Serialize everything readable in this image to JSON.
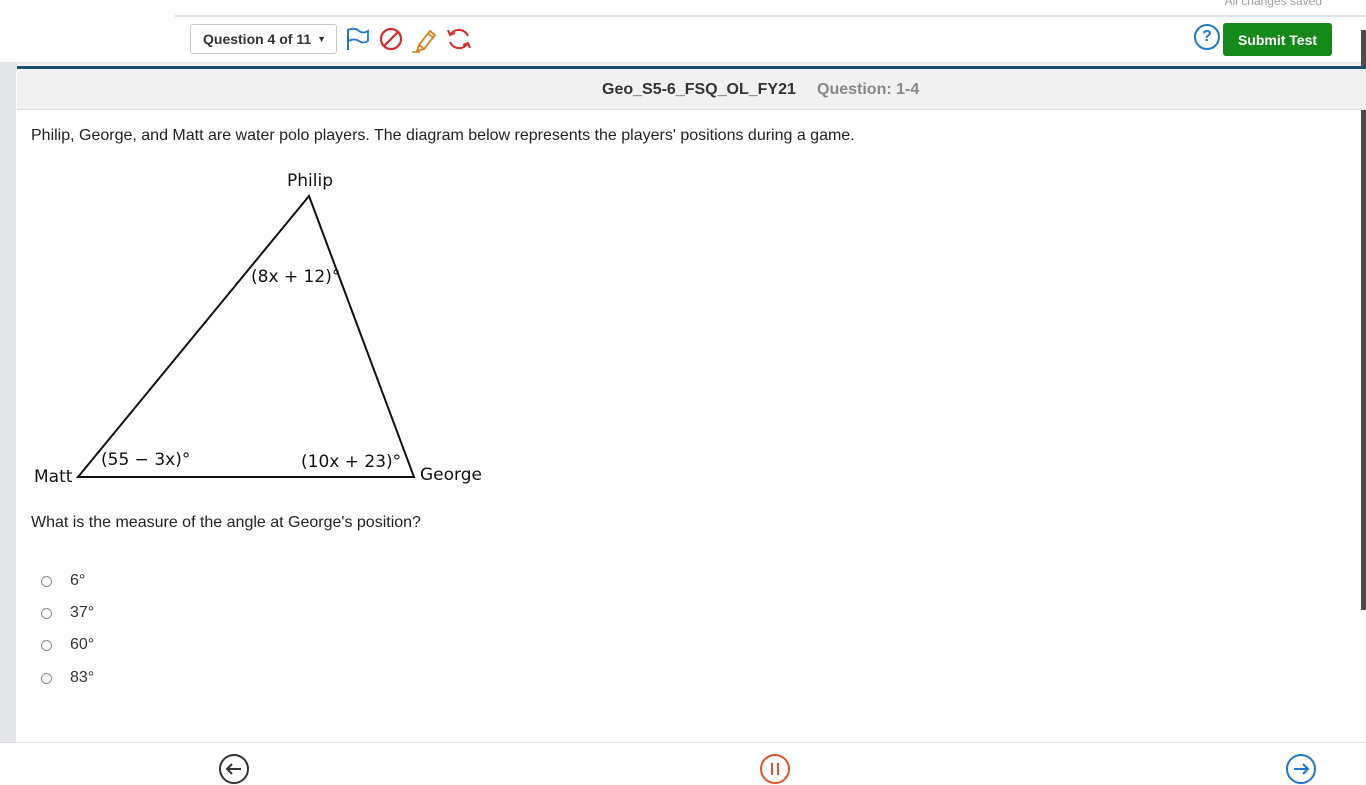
{
  "topbar": {
    "save_status": "All changes saved",
    "question_selector": "Question 4 of 11",
    "icons": [
      "flag-icon",
      "strikethrough-icon",
      "highlighter-icon",
      "reset-icon"
    ],
    "help_label": "?",
    "submit_label": "Submit Test"
  },
  "header": {
    "test_name": "Geo_S5-6_FSQ_OL_FY21",
    "question_code": "Question: 1-4"
  },
  "question": {
    "stem": "Philip, George, and Matt are water polo players.  The diagram below represents the players' positions during a game.",
    "diagram": {
      "vertex_philip": "Philip",
      "vertex_george": "George",
      "vertex_matt": "Matt",
      "angle_philip": "(8x + 12)°",
      "angle_george": "(10x + 23)°",
      "angle_matt": "(55 − 3x)°"
    },
    "prompt": "What is the measure of the angle at George's position?",
    "choices": [
      "6°",
      "37°",
      "60°",
      "83°"
    ]
  },
  "bottom_nav": {
    "icons": [
      "back-arrow-icon",
      "pause-icon",
      "forward-arrow-icon"
    ]
  },
  "colors": {
    "submit_green": "#15891a",
    "help_blue": "#1f78c8",
    "strike_red": "#d62b2b",
    "pause_orange": "#d9542a",
    "header_rule": "#1c4f6d"
  }
}
